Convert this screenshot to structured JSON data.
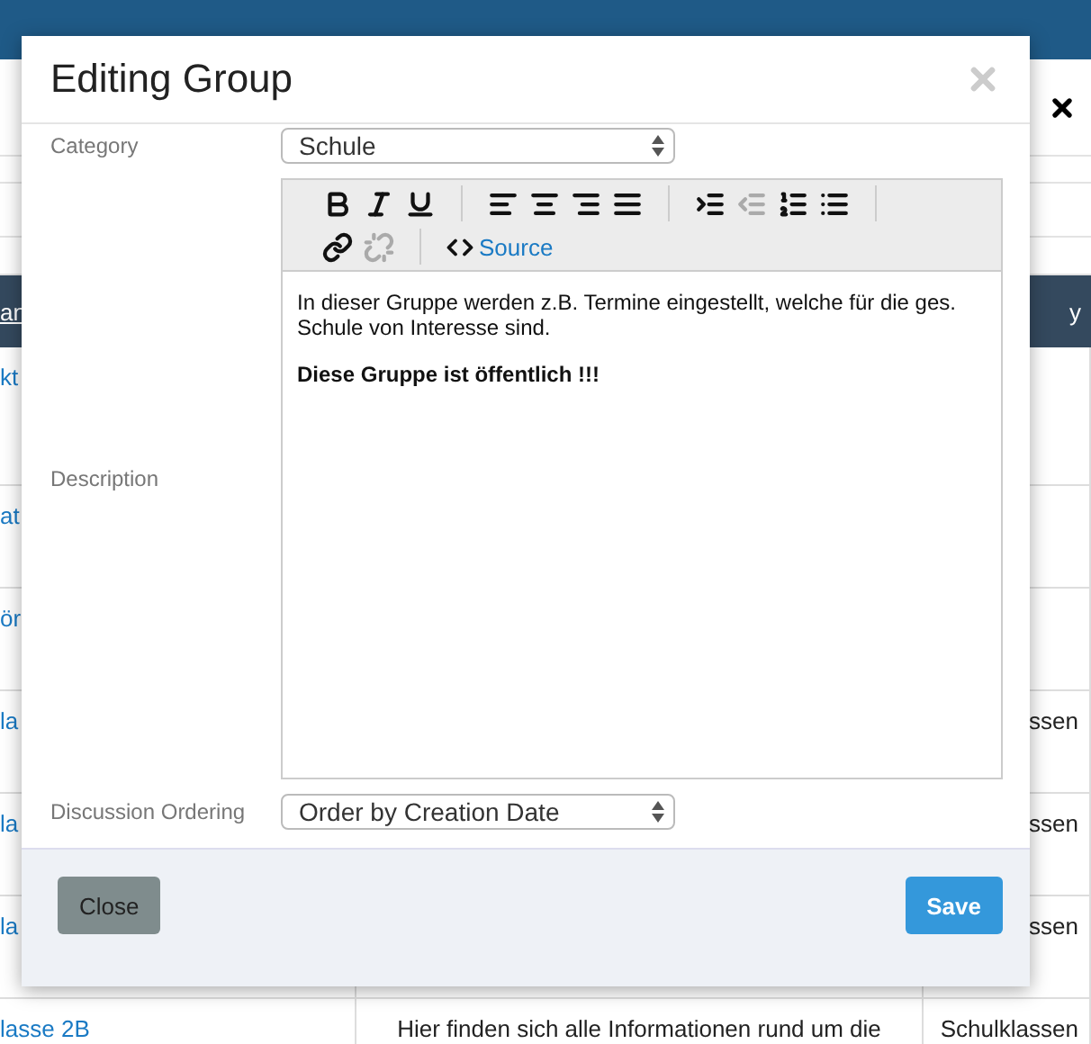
{
  "background": {
    "header": {
      "column_1": "an",
      "column_3": "y"
    },
    "rows": [
      {
        "column_1": "kt"
      },
      {
        "column_1": "at"
      },
      {
        "column_1": "ör"
      },
      {
        "column_1": "la",
        "column_3": "ssen"
      },
      {
        "column_1": "la",
        "column_3": "ssen"
      },
      {
        "column_1": "la",
        "column_3": "ssen"
      },
      {
        "column_1": "lasse 2B",
        "column_2": "Hier finden sich alle Informationen rund um die",
        "column_3": "Schulklassen"
      }
    ]
  },
  "dialog": {
    "title": "Editing Group",
    "fields": [
      {
        "kind": "select",
        "label": "Category",
        "value": "Schule"
      },
      {
        "kind": "editor",
        "label": "Description",
        "toolbar": [
          [
            {
              "kind": "bold",
              "disabled": false
            },
            {
              "kind": "italic",
              "disabled": false
            },
            {
              "kind": "underline",
              "disabled": false
            },
            {
              "kind": "separator"
            },
            {
              "kind": "align-left",
              "disabled": false
            },
            {
              "kind": "align-center",
              "disabled": false
            },
            {
              "kind": "align-right",
              "disabled": false
            },
            {
              "kind": "align-justify",
              "disabled": false
            },
            {
              "kind": "separator"
            },
            {
              "kind": "indent",
              "disabled": false
            },
            {
              "kind": "outdent",
              "disabled": true
            },
            {
              "kind": "numbered-list",
              "disabled": false
            },
            {
              "kind": "bullet-list",
              "disabled": false
            },
            {
              "kind": "separator"
            }
          ],
          [
            {
              "kind": "link",
              "disabled": false
            },
            {
              "kind": "unlink",
              "disabled": true
            },
            {
              "kind": "separator"
            },
            {
              "kind": "source",
              "label": "Source",
              "disabled": false
            }
          ]
        ],
        "paragraphs": [
          {
            "text": "In dieser Gruppe werden z.B. Termine eingestellt, welche für die ges. Schule von Interesse sind.",
            "bold": false
          },
          {
            "text": "Diese Gruppe ist öffentlich !!!",
            "bold": true
          }
        ]
      },
      {
        "kind": "select",
        "label": "Discussion Ordering",
        "value": "Order by Creation Date"
      }
    ],
    "buttons": [
      {
        "label": "Close",
        "kind": "secondary"
      },
      {
        "label": "Save",
        "kind": "primary"
      }
    ]
  }
}
